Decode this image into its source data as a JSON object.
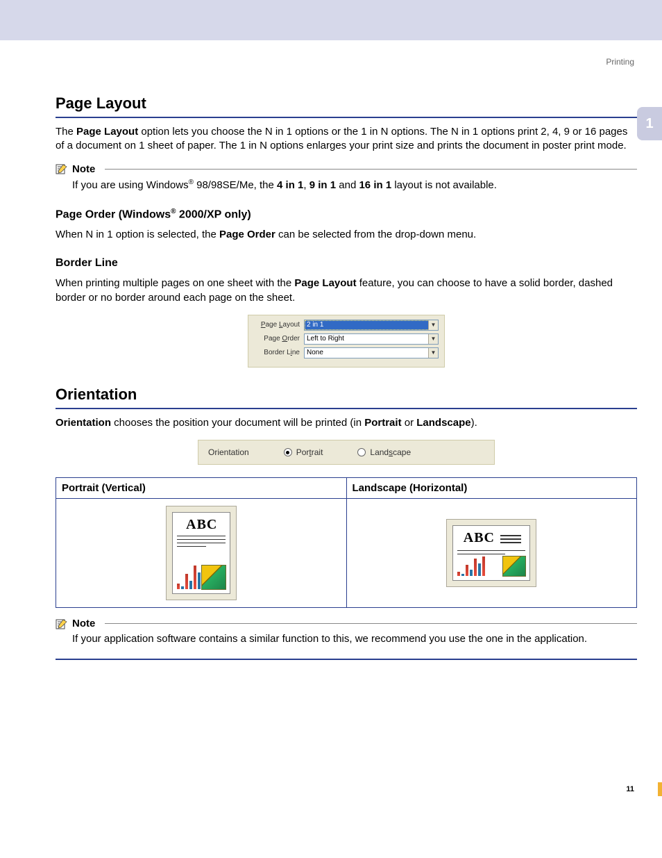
{
  "header": {
    "section_label": "Printing",
    "side_tab": "1"
  },
  "page_layout": {
    "heading": "Page Layout",
    "intro_pre": "The ",
    "intro_bold": "Page Layout",
    "intro_post": " option lets you choose the N in 1 options or the 1 in N options. The N in 1 options print 2, 4, 9 or 16 pages of a document on 1 sheet of paper. The 1 in N options enlarges your print size and prints the document in poster print mode.",
    "note_label": "Note",
    "note_pre": "If you are using Windows",
    "note_mid1": " 98/98SE/Me, the ",
    "note_b1": "4 in 1",
    "note_sep1": ", ",
    "note_b2": "9 in 1",
    "note_sep2": " and ",
    "note_b3": "16 in 1",
    "note_post": " layout is not available."
  },
  "page_order": {
    "heading_pre": "Page Order (Windows",
    "heading_post": " 2000/XP only)",
    "body_pre": "When N in 1 option is selected, the ",
    "body_bold": "Page Order",
    "body_post": " can be selected from the drop-down menu."
  },
  "border_line": {
    "heading": "Border Line",
    "body_pre": "When printing multiple pages on one sheet with the ",
    "body_bold": "Page Layout",
    "body_post": " feature, you can choose to have a solid border, dashed border or no border around each page on the sheet."
  },
  "settings_panel": {
    "rows": [
      {
        "label": "Page Layout",
        "value": "2 in 1",
        "selected": true
      },
      {
        "label": "Page Order",
        "value": "Left to Right",
        "selected": false
      },
      {
        "label": "Border Line",
        "value": "None",
        "selected": false
      }
    ]
  },
  "orientation": {
    "heading": "Orientation",
    "body_b1": "Orientation",
    "body_mid": " chooses the position your document will be printed (in ",
    "body_b2": "Portrait",
    "body_or": " or ",
    "body_b3": "Landscape",
    "body_post": ").",
    "strip_label": "Orientation",
    "radio_portrait": "Portrait",
    "radio_landscape": "Landscape",
    "table": {
      "col1": "Portrait (Vertical)",
      "col2": "Landscape (Horizontal)",
      "sample_text": "ABC"
    },
    "note_label": "Note",
    "note_body": "If your application software contains a similar function to this, we recommend you use the one in the application."
  },
  "page_number": "11"
}
